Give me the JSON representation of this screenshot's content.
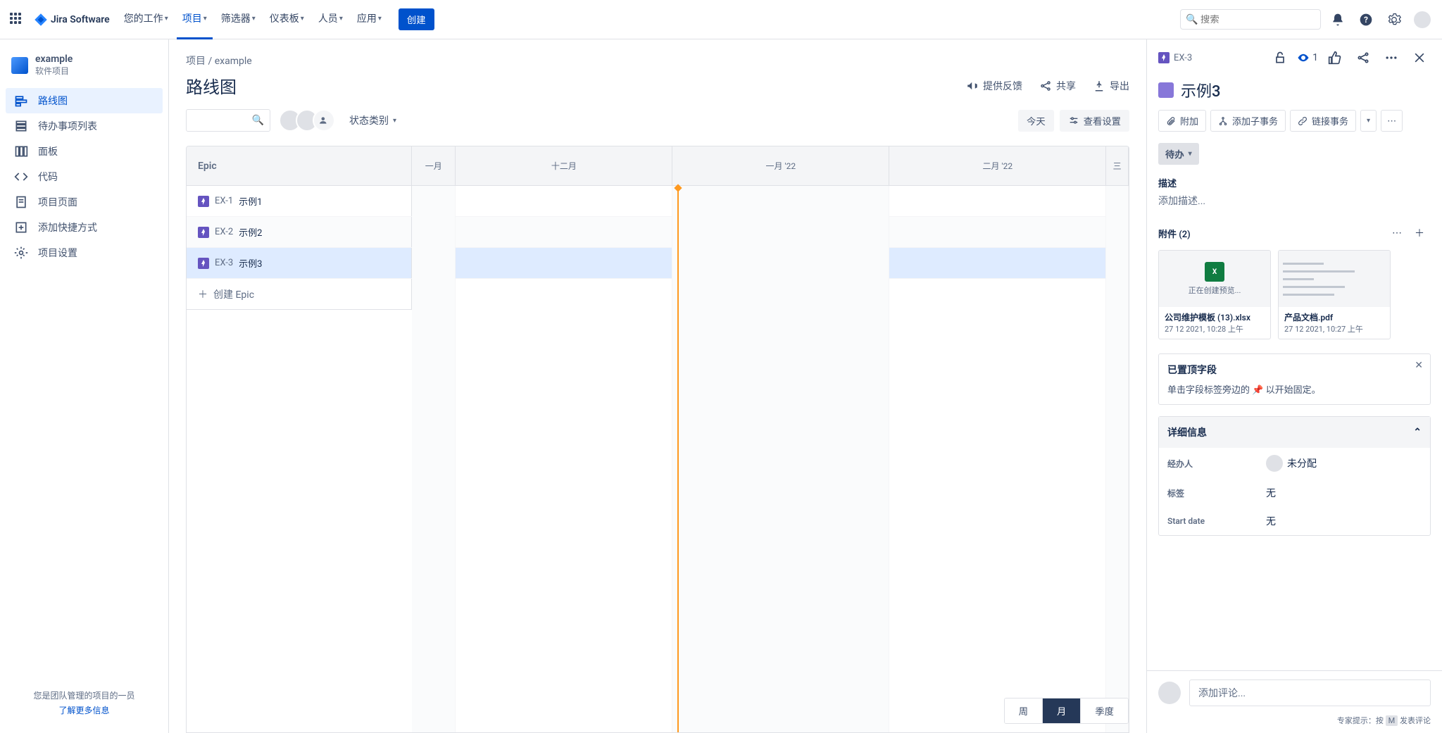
{
  "topnav": {
    "product": "Jira Software",
    "items": [
      "您的工作",
      "项目",
      "筛选器",
      "仪表板",
      "人员",
      "应用"
    ],
    "activeIndex": 1,
    "create": "创建",
    "searchPlaceholder": "搜索"
  },
  "sidebar": {
    "project": {
      "name": "example",
      "type": "软件项目"
    },
    "items": [
      {
        "label": "路线图",
        "icon": "roadmap",
        "active": true
      },
      {
        "label": "待办事项列表",
        "icon": "backlog"
      },
      {
        "label": "面板",
        "icon": "board"
      },
      {
        "label": "代码",
        "icon": "code"
      },
      {
        "label": "项目页面",
        "icon": "page"
      },
      {
        "label": "添加快捷方式",
        "icon": "add"
      },
      {
        "label": "项目设置",
        "icon": "settings"
      }
    ],
    "footer": {
      "line1": "您是团队管理的项目的一员",
      "link": "了解更多信息"
    }
  },
  "breadcrumb": {
    "root": "项目",
    "sep": " / ",
    "current": "example"
  },
  "page": {
    "title": "路线图",
    "actions": {
      "feedback": "提供反馈",
      "share": "共享",
      "export": "导出"
    },
    "toolbar": {
      "statusFilter": "状态类别",
      "today": "今天",
      "viewSettings": "查看设置"
    }
  },
  "roadmap": {
    "epicHeader": "Epic",
    "months": [
      "一月",
      "十二月",
      "一月 '22",
      "二月 '22",
      "三"
    ],
    "epics": [
      {
        "key": "EX-1",
        "title": "示例1",
        "selected": false,
        "alt": false
      },
      {
        "key": "EX-2",
        "title": "示例2",
        "selected": false,
        "alt": true
      },
      {
        "key": "EX-3",
        "title": "示例3",
        "selected": true,
        "alt": false
      }
    ],
    "createEpic": "创建 Epic",
    "zoom": {
      "options": [
        "周",
        "月",
        "季度"
      ],
      "activeIndex": 1
    }
  },
  "detail": {
    "key": "EX-3",
    "watchers": "1",
    "title": "示例3",
    "actions": {
      "attach": "附加",
      "addChild": "添加子事务",
      "link": "链接事务"
    },
    "status": "待办",
    "description": {
      "label": "描述",
      "placeholder": "添加描述..."
    },
    "attachments": {
      "label": "附件 (2)",
      "items": [
        {
          "name": "公司维护模板 (13).xlsx",
          "date": "27 12 2021, 10:28 上午",
          "type": "xlsx",
          "previewText": "正在创建预览..."
        },
        {
          "name": "产品文档.pdf",
          "date": "27 12 2021, 10:27 上午",
          "type": "pdf"
        }
      ]
    },
    "pinned": {
      "title": "已置顶字段",
      "text_before": "单击字段标签旁边的 ",
      "text_after": " 以开始固定。"
    },
    "detailsBox": {
      "title": "详细信息",
      "fields": [
        {
          "label": "经办人",
          "value": "未分配",
          "hasAvatar": true
        },
        {
          "label": "标签",
          "value": "无"
        },
        {
          "label": "Start date",
          "value": "无"
        }
      ]
    },
    "comment": {
      "placeholder": "添加评论...",
      "hint_before": "专家提示：按 ",
      "hint_key": "M",
      "hint_after": " 发表评论"
    }
  }
}
